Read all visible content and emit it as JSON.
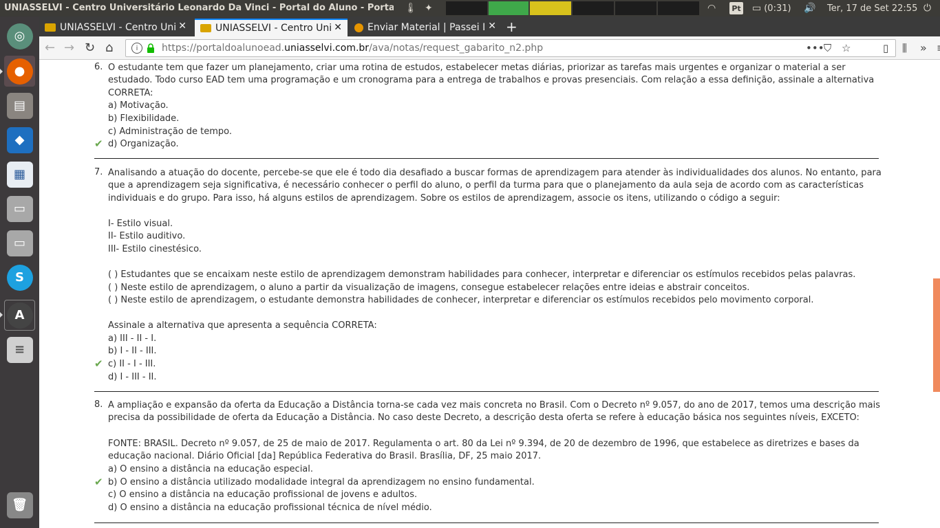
{
  "panel": {
    "window_title": "UNIASSELVI - Centro Universitário Leonardo Da Vinci - Portal do Aluno - Portal",
    "battery": "(0:31)",
    "lang": "Pt",
    "clock": "Ter, 17 de Set 22:55"
  },
  "browser": {
    "tabs": [
      {
        "label": "UNIASSELVI - Centro Uni"
      },
      {
        "label": "UNIASSELVI - Centro Uni"
      },
      {
        "label": "Enviar Material | Passei D"
      }
    ],
    "url_prefix": "https://portaldoalunoead.",
    "url_domain": "uniasselvi.com.br",
    "url_path": "/ava/notas/request_gabarito_n2.php",
    "more_label": "•••"
  },
  "questions": [
    {
      "number": "6.",
      "lines": [
        "O estudante tem que fazer um planejamento, criar uma rotina de estudos, estabelecer metas diárias, priorizar as tarefas mais urgentes e organizar o material a ser",
        "estudado. Todo curso EAD tem uma programação e um cronograma para a entrega de trabalhos e provas presenciais. Com relação a essa definição, assinale a alternativa",
        "CORRETA:"
      ],
      "options": [
        "a)  Motivação.",
        "b)  Flexibilidade.",
        "c)  Administração de tempo.",
        "d)  Organização."
      ],
      "correct_index": 3
    },
    {
      "number": "7.",
      "lines": [
        "Analisando a atuação do docente, percebe-se que ele é todo dia desafiado a buscar formas de aprendizagem para atender às individualidades dos alunos. No entanto, para",
        "que a aprendizagem seja significativa, é necessário conhecer o perfil do aluno, o perfil da turma para que o planejamento da aula seja de acordo com as características",
        "individuais e do grupo. Para isso, há alguns estilos de aprendizagem. Sobre os estilos de aprendizagem, associe os itens, utilizando o código a seguir:",
        "",
        "I- Estilo visual.",
        "II- Estilo auditivo.",
        "III- Estilo cinestésico.",
        "",
        "(     ) Estudantes que se encaixam neste estilo de aprendizagem demonstram habilidades para conhecer, interpretar e diferenciar os estímulos recebidos pelas palavras.",
        "(     ) Neste estilo de aprendizagem, o aluno a partir da visualização de imagens, consegue estabelecer relações entre ideias e abstrair conceitos.",
        "(     ) Neste estilo de aprendizagem, o estudante demonstra habilidades de conhecer, interpretar e diferenciar os estímulos recebidos pelo movimento corporal.",
        "",
        "Assinale a alternativa que apresenta a sequência CORRETA:"
      ],
      "options": [
        "a)  III - II - I.",
        "b)  I - II - III.",
        "c)  II - I - III.",
        "d)  I - III - II."
      ],
      "correct_index": 2
    },
    {
      "number": "8.",
      "lines": [
        "A ampliação e expansão da oferta da Educação a Distância torna-se cada vez mais concreta no Brasil. Com o Decreto nº 9.057, do ano de 2017, temos uma descrição mais",
        "precisa da possibilidade de oferta da Educação a Distância. No caso deste Decreto, a descrição desta oferta se refere à educação básica nos seguintes níveis, EXCETO:",
        "",
        "FONTE: BRASIL. Decreto nº 9.057, de 25 de maio de 2017. Regulamenta o art. 80 da Lei nº 9.394, de 20 de dezembro de 1996, que estabelece as diretrizes e bases da",
        "educação nacional. Diário Oficial [da] República Federativa do Brasil. Brasília, DF, 25 maio 2017."
      ],
      "options": [
        "a)  O ensino a distância na educação especial.",
        "b)  O ensino a distância utilizado modalidade integral da aprendizagem no ensino fundamental.",
        "c)  O ensino a distância na educação profissional de jovens e adultos.",
        "d)  O ensino a distância na educação profissional técnica de nível médio."
      ],
      "correct_index": 1
    }
  ]
}
